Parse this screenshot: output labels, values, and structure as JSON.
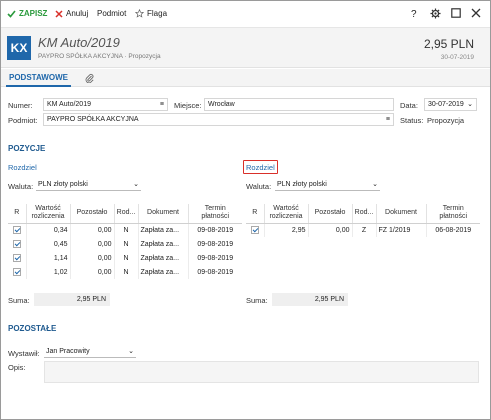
{
  "toolbar": {
    "save": "ZAPISZ",
    "cancel": "Anuluj",
    "subject": "Podmiot",
    "flag": "Flaga",
    "help": "?"
  },
  "header": {
    "badge": "KX",
    "title": "KM Auto/2019",
    "subtitle": "PAYPRO SPÓŁKA AKCYJNA · Propozycja",
    "amount": "2,95 PLN",
    "date": "30-07-2019"
  },
  "tabs": {
    "main": "PODSTAWOWE"
  },
  "form": {
    "number_label": "Numer:",
    "number_value": "KM Auto/2019",
    "place_label": "Miejsce:",
    "place_value": "Wrocław",
    "date_label": "Data:",
    "date_value": "30-07-2019",
    "subject_label": "Podmiot:",
    "subject_value": "PAYPRO SPÓŁKA AKCYJNA",
    "status_label": "Status:",
    "status_value": "Propozycja"
  },
  "positions": {
    "title": "POZYCJE",
    "left": {
      "link": "Rozdziel",
      "currency_label": "Waluta:",
      "currency_value": "PLN  złoty polski",
      "headers": [
        "R",
        "Wartość rozliczenia",
        "Pozostało",
        "Rod...",
        "Dokument",
        "Termin płatności"
      ],
      "rows": [
        {
          "value": "0,34",
          "left": "0,00",
          "kind": "N",
          "doc": "Zapłata za...",
          "due": "09-08-2019"
        },
        {
          "value": "0,45",
          "left": "0,00",
          "kind": "N",
          "doc": "Zapłata za...",
          "due": "09-08-2019"
        },
        {
          "value": "1,14",
          "left": "0,00",
          "kind": "N",
          "doc": "Zapłata za...",
          "due": "09-08-2019"
        },
        {
          "value": "1,02",
          "left": "0,00",
          "kind": "N",
          "doc": "Zapłata za...",
          "due": "09-08-2019"
        }
      ],
      "sum_label": "Suma:",
      "sum_value": "2,95 PLN"
    },
    "right": {
      "link": "Rozdziel",
      "currency_label": "Waluta:",
      "currency_value": "PLN  złoty polski",
      "headers": [
        "R",
        "Wartość rozliczenia",
        "Pozostało",
        "Rod...",
        "Dokument",
        "Termin płatności"
      ],
      "rows": [
        {
          "value": "2,95",
          "left": "0,00",
          "kind": "Z",
          "doc": "FZ 1/2019",
          "due": "06-08-2019"
        }
      ],
      "sum_label": "Suma:",
      "sum_value": "2,95 PLN"
    }
  },
  "other": {
    "title": "POZOSTAŁE",
    "issuer_label": "Wystawił:",
    "issuer_value": "Jan Pracowity",
    "desc_label": "Opis:",
    "desc_value": ""
  },
  "colors": {
    "accent": "#1f67aa",
    "save_green": "#2a9a3c",
    "cancel_red": "#d9302a",
    "highlight": "#d9302a"
  }
}
